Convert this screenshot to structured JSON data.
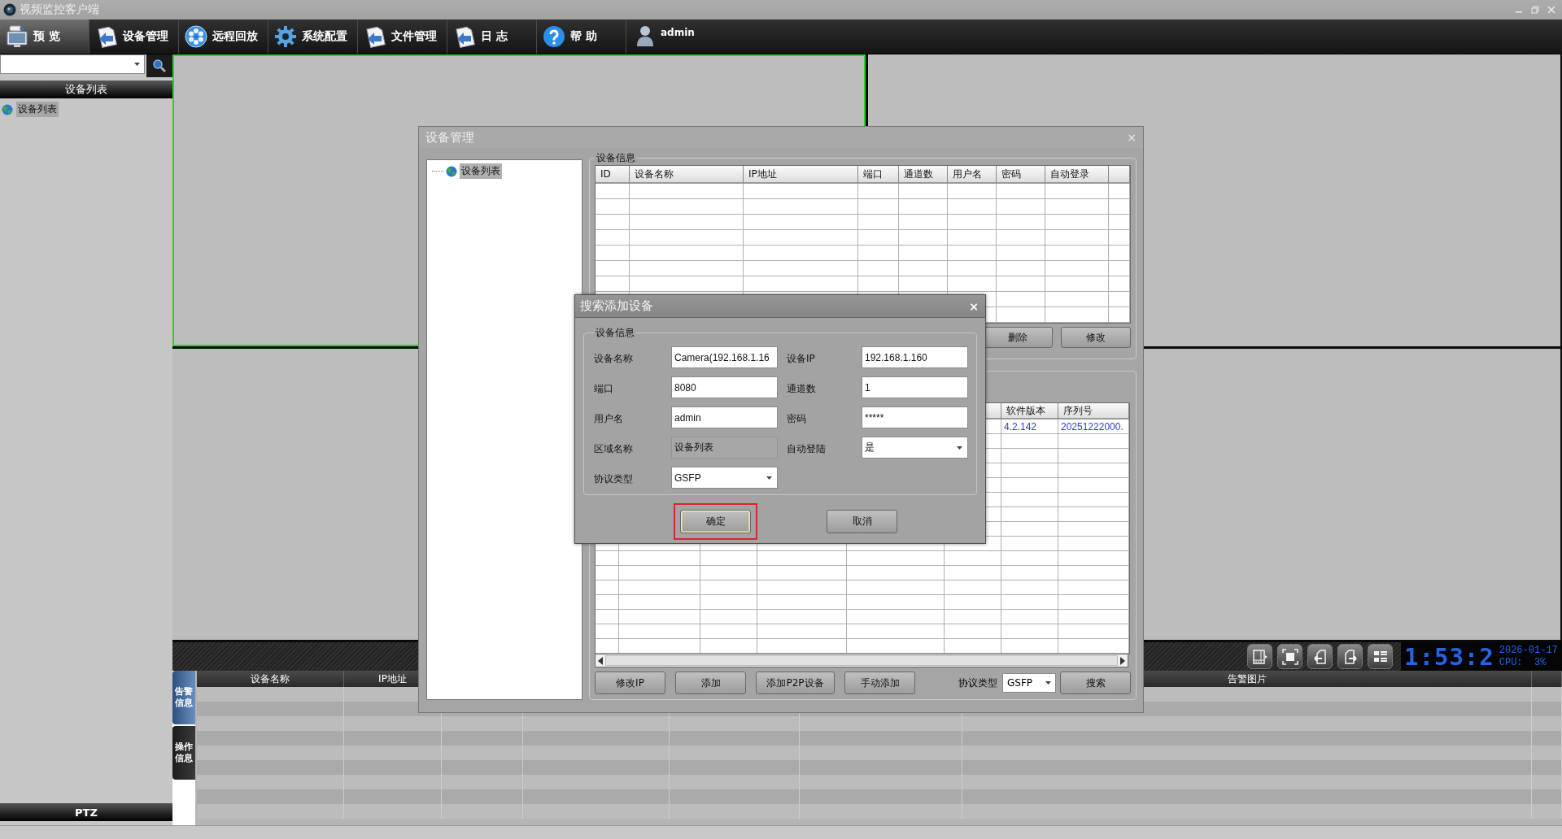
{
  "window": {
    "title": "视频监控客户端"
  },
  "toolbar": [
    {
      "label": "预 览",
      "selected": true
    },
    {
      "label": "设备管理",
      "selected": false
    },
    {
      "label": "远程回放",
      "selected": false
    },
    {
      "label": "系统配置",
      "selected": false
    },
    {
      "label": "文件管理",
      "selected": false
    },
    {
      "label": "日 志",
      "selected": false
    },
    {
      "label": "帮 助",
      "selected": false
    }
  ],
  "user": {
    "name": "admin"
  },
  "sidebar": {
    "header": "设备列表",
    "tree": [
      {
        "label": "设备列表",
        "selected": true
      }
    ],
    "footer": "PTZ"
  },
  "video_grid": {
    "cells": [
      {
        "selected": true
      },
      {
        "selected": false
      },
      {
        "selected": false
      },
      {
        "selected": false
      }
    ]
  },
  "control_bar": {
    "time": "1:53:2",
    "date": "2026-01-17",
    "cpu": "CPU:  3%"
  },
  "alarm_panel": {
    "tabs": [
      {
        "label": "告警信息",
        "selected": true
      },
      {
        "label": "操作信息",
        "selected": false
      }
    ],
    "columns": [
      "设备名称",
      "IP地址",
      "告警图片"
    ]
  },
  "device_manager": {
    "title": "设备管理",
    "close": "×",
    "tree": [
      {
        "label": "设备列表",
        "selected": true
      }
    ],
    "device_info": {
      "legend": "设备信息",
      "columns": [
        "ID",
        "设备名称",
        "IP地址",
        "端口",
        "通道数",
        "用户名",
        "密码",
        "自动登录"
      ],
      "buttons": [
        "删除",
        "修改"
      ]
    },
    "search_results": {
      "columns": [
        "软件版本",
        "序列号"
      ],
      "rows": [
        [
          "4.2.142",
          "20251222000."
        ]
      ]
    },
    "buttons": [
      "修改IP",
      "添加",
      "添加P2P设备",
      "手动添加"
    ],
    "protocol": {
      "label": "协议类型",
      "value": "GSFP"
    },
    "search_button": "搜索"
  },
  "search_dialog": {
    "title": "搜索添加设备",
    "close": "×",
    "legend": "设备信息",
    "fields": [
      {
        "label": "设备名称",
        "value": "Camera(192.168.1.16",
        "kind": "text"
      },
      {
        "label": "设备IP",
        "value": "192.168.1.160",
        "kind": "text"
      },
      {
        "label": "端口",
        "value": "8080",
        "kind": "text"
      },
      {
        "label": "通道数",
        "value": "1",
        "kind": "text"
      },
      {
        "label": "用户名",
        "value": "admin",
        "kind": "text"
      },
      {
        "label": "密码",
        "value": "*****",
        "kind": "text"
      },
      {
        "label": "区域名称",
        "value": "设备列表",
        "kind": "readonly"
      },
      {
        "label": "自动登陆",
        "value": "是",
        "kind": "select"
      },
      {
        "label": "协议类型",
        "value": "GSFP",
        "kind": "select"
      }
    ],
    "buttons": [
      {
        "label": "确定",
        "highlighted": true,
        "focused": true
      },
      {
        "label": "取消",
        "highlighted": false,
        "focused": false
      }
    ]
  }
}
